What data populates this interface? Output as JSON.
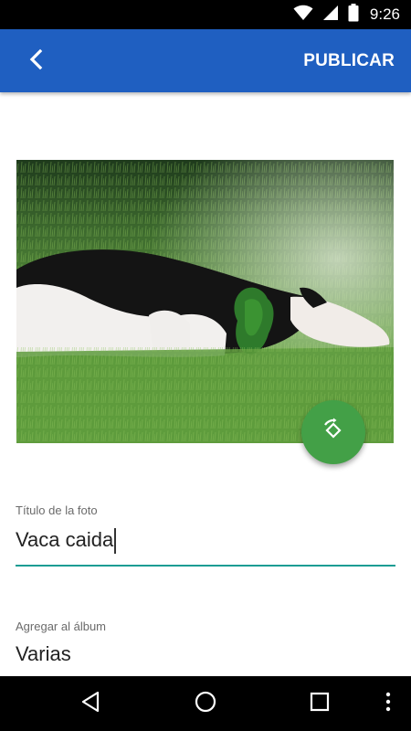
{
  "status_bar": {
    "time": "9:26",
    "icons": [
      "wifi-icon",
      "cellular-signal-icon",
      "battery-icon"
    ]
  },
  "app_bar": {
    "back_icon": "chevron-left-icon",
    "publish_label": "PUBLICAR",
    "color": "#1f5fc1"
  },
  "photo": {
    "subject": "cow-lying-on-grass",
    "rotate_icon": "rotate-icon",
    "fab_color": "#43a047"
  },
  "form": {
    "title_label": "Título de la foto",
    "title_value": "Vaca caida",
    "album_label": "Agregar al álbum",
    "album_value": "Varias",
    "accent": "#1a9c93"
  },
  "nav_bar": {
    "buttons": [
      "back-triangle-icon",
      "home-circle-icon",
      "recents-square-icon",
      "more-vert-icon"
    ]
  }
}
